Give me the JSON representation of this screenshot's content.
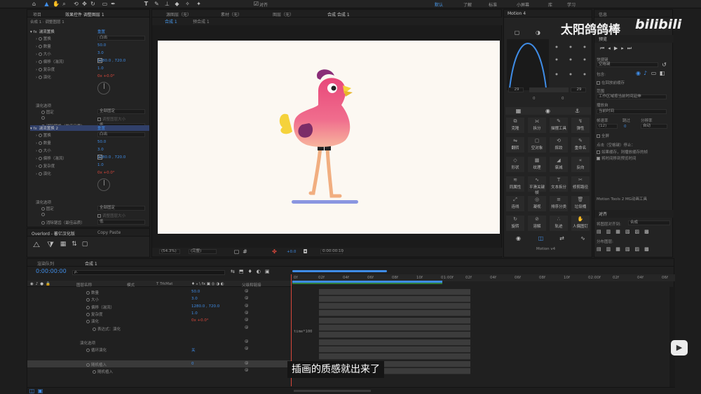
{
  "menubar": {
    "workspaces": [
      "默认",
      "了解",
      "标准",
      "小屏幕",
      "库",
      "学习"
    ],
    "align_label": "对齐"
  },
  "effect_controls": {
    "tabs": [
      "项目",
      "效果控件 调整图层 1"
    ],
    "breadcrumb": "合成 1 · 调整图层 1",
    "blocks": [
      {
        "name": "湍流置换",
        "reset": "重置",
        "props": [
          {
            "label": "置换",
            "value": "凸出",
            "kind": "dropdown"
          },
          {
            "label": "数量",
            "value": "50.0"
          },
          {
            "label": "大小",
            "value": "3.0"
          },
          {
            "label": "偏移（湍流）",
            "value": "1280.0 , 720.0"
          },
          {
            "label": "复杂度",
            "value": "1.0"
          },
          {
            "label": "演化",
            "value": "0x +0.0°",
            "red": true
          }
        ],
        "options_title": "演化选项",
        "options": [
          {
            "label": "固定",
            "value": "全部固定",
            "kind": "dropdown"
          },
          {
            "label": "",
            "value": "调整图层大小"
          },
          {
            "label": "消除锯齿（最佳品质）",
            "value": "低",
            "kind": "dropdown"
          }
        ]
      },
      {
        "name": "湍流置换 2",
        "reset": "重置",
        "props": [
          {
            "label": "置换",
            "value": "凸出",
            "kind": "dropdown"
          },
          {
            "label": "数量",
            "value": "50.0"
          },
          {
            "label": "大小",
            "value": "3.0"
          },
          {
            "label": "偏移（湍流）",
            "value": "1280.0 , 720.0"
          },
          {
            "label": "复杂度",
            "value": "1.0"
          },
          {
            "label": "演化",
            "value": "0x +0.0°",
            "red": true
          }
        ],
        "options_title": "演化选项",
        "options": [
          {
            "label": "固定",
            "value": "全部固定",
            "kind": "dropdown"
          },
          {
            "label": "",
            "value": "调整图层大小"
          },
          {
            "label": "消除锯齿（最佳品质）",
            "value": "低",
            "kind": "dropdown"
          }
        ]
      }
    ]
  },
  "bottom_left": {
    "tabs": [
      "Overlord - 蕃亿汉化版",
      "Copy Paste"
    ]
  },
  "viewer": {
    "top_tabs": [
      "源图层（无）",
      "素材（无）",
      "图层（无）",
      "合成 合成 1"
    ],
    "sub_tabs": [
      "合成 1",
      "预合成 1"
    ],
    "zoom": "(54.3%)",
    "quality": "(完整)",
    "exposure": "+0.0",
    "timecode": "0:00:00:10"
  },
  "motion4": {
    "title": "Motion 4",
    "left_val": "29",
    "right_val": "29",
    "zero_a": "0",
    "zero_b": "0",
    "buttons": [
      "克隆",
      "拆分",
      "描摆工具",
      "弹性",
      "翻转",
      "空对象",
      "摔跤",
      "重命名",
      "形状",
      "纹理",
      "衰减",
      "反向",
      "同属性",
      "平滑关键帧",
      "文本拆分",
      "修剪路径",
      "连线",
      "凝视",
      "排序分类",
      "垃圾桶",
      "旋转",
      "溶解",
      "轨迹",
      "人偶图钉"
    ],
    "footer": "Motion v4"
  },
  "info_panel": {
    "tabs": [
      "信息",
      "预览"
    ],
    "shortcut_label": "快捷键",
    "shortcut_value": "空格键",
    "include_label": "包含:",
    "cached_label": "在回放前缓存",
    "range_label": "范围",
    "range_value": "工作区域按当前时间延伸",
    "playfrom_label": "播放自",
    "playfrom_value": "当前时间",
    "fps_label": "帧速率",
    "skip_label": "跳过",
    "res_label": "分辨率",
    "fps_value": "(12)",
    "skip_value": "0",
    "res_value": "自动",
    "fullscreen_label": "全屏",
    "stop_label": "点击（空格键）停止：",
    "check1": "如果缓存，则播放缓存的帧",
    "check2": "将时间移到预览时间",
    "mg_label": "Motion Tools 2 MG动画工具",
    "align_title": "对齐",
    "align_to_label": "将图层对齐到:",
    "align_to_value": "合成",
    "distribute_label": "分布图层:"
  },
  "watermark": {
    "author": "太阳鸽鸽棒",
    "logo": "bilibili"
  },
  "timeline": {
    "tabs": [
      "渲染队列",
      "合成 1"
    ],
    "timecode": "0:00:00:00",
    "search_placeholder": "ρ.",
    "col_layer": "图层名称",
    "col_mode": "模式",
    "col_trkmat": "T TrkMat",
    "col_parent": "父级和链接",
    "ruler": [
      "0f",
      "02f",
      "04f",
      "06f",
      "08f",
      "10f",
      "01:00f",
      "02f",
      "04f",
      "06f",
      "08f",
      "10f",
      "02:00f",
      "02f",
      "04f",
      "06f"
    ],
    "rows": [
      {
        "label": "数量",
        "value": "50.0",
        "indent": 2
      },
      {
        "label": "大小",
        "value": "3.0",
        "indent": 2
      },
      {
        "label": "偏移（湍流）",
        "value": "1280.0 , 720.0",
        "indent": 2
      },
      {
        "label": "复杂度",
        "value": "1.0",
        "indent": 2
      },
      {
        "label": "演化",
        "value": "0x +0.0°",
        "indent": 2,
        "red": true
      },
      {
        "label": "表达式：演化",
        "value": "",
        "indent": 3
      },
      {
        "label": "",
        "value": "",
        "indent": 0
      },
      {
        "label": "演化选项",
        "value": "",
        "indent": 1
      },
      {
        "label": "循环演化",
        "value": "关",
        "indent": 2
      },
      {
        "label": "",
        "value": "",
        "indent": 2
      },
      {
        "label": "随机植入",
        "value": "0",
        "indent": 2,
        "selected": true
      },
      {
        "label": "随机植入",
        "value": "",
        "indent": 3
      }
    ],
    "expression": "time*100",
    "subtitle": "插画的质感就出来了"
  }
}
